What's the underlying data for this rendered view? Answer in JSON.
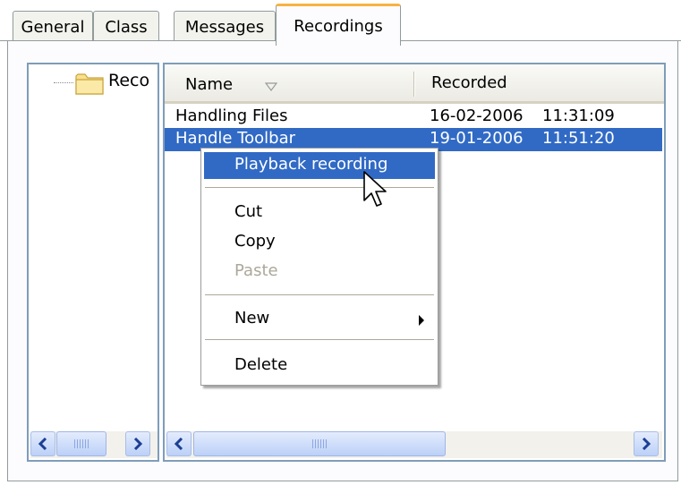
{
  "tabs": [
    {
      "label": "General",
      "active": false
    },
    {
      "label": "Class",
      "active": false
    },
    {
      "label": "Messages",
      "active": false
    },
    {
      "label": "Recordings",
      "active": true
    }
  ],
  "tree": {
    "root_label": "Reco"
  },
  "list": {
    "columns": {
      "name": "Name",
      "recorded": "Recorded"
    },
    "rows": [
      {
        "name": "Handling Files",
        "date": "16-02-2006",
        "time": "11:31:09",
        "selected": false
      },
      {
        "name": "Handle Toolbar",
        "date": "19-01-2006",
        "time": "11:51:20",
        "selected": true
      }
    ]
  },
  "context_menu": {
    "items": {
      "playback": "Playback recording",
      "cut": "Cut",
      "copy": "Copy",
      "paste": "Paste",
      "new": "New",
      "delete": "Delete"
    },
    "highlighted": "playback",
    "disabled": [
      "paste"
    ]
  },
  "colors": {
    "selection": "#316ac5",
    "active_tab_accent": "#f7b243",
    "pane_border": "#7f9db9"
  },
  "icons": [
    "folder-icon",
    "sort-descending-icon",
    "scroll-left-icon",
    "scroll-right-icon",
    "submenu-arrow-icon",
    "mouse-pointer-icon"
  ]
}
